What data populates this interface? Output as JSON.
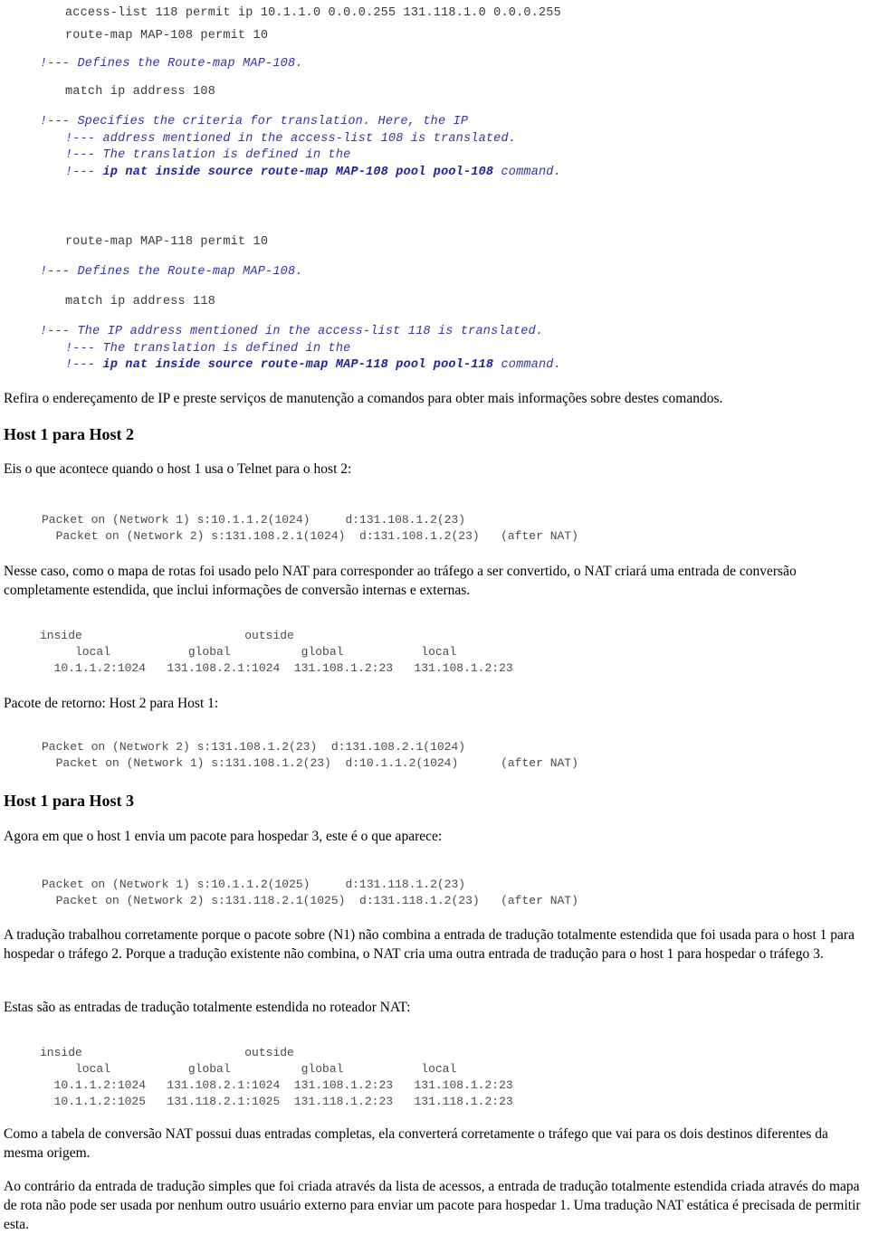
{
  "colors": {
    "comment_blue": "#3333aa",
    "comment_blue_bold": "#2222a0",
    "code_gray": "#3a3a3a",
    "body_black": "#000000",
    "page_background": "#ffffff"
  },
  "config_block_1": {
    "acl_line": "access-list 118 permit ip 10.1.1.0 0.0.0.255 131.118.1.0 0.0.0.255",
    "routemap_line": "route-map MAP-108 permit 10",
    "comment_defines": "!--- Defines the Route-map MAP-108.",
    "match_line": "match ip address 108",
    "comment_specifies_1": "!--- Specifies the criteria for translation. Here, the IP",
    "comment_specifies_2": "!--- address mentioned in the access-list 108 is translated.",
    "comment_specifies_3": "!--- The translation is defined in the",
    "comment_specifies_4_prefix": "!--- ",
    "comment_specifies_4_bold": "ip nat inside source route-map MAP-108 pool pool-108",
    "comment_specifies_4_suffix": " command."
  },
  "config_block_2": {
    "routemap_line": "route-map MAP-118 permit 10",
    "comment_defines": "!--- Defines the Route-map MAP-108.",
    "match_line": "match ip address 118",
    "comment_1": "!--- The IP address mentioned in the access-list 118 is translated.",
    "comment_2": "!--- The translation is defined in the",
    "comment_3_prefix": "!--- ",
    "comment_3_bold": "ip nat inside source route-map MAP-118 pool pool-118",
    "comment_3_suffix": " command."
  },
  "paragraphs": {
    "refira": "Refira o endereçamento de IP e preste serviços de manutenção a comandos para obter mais informações sobre destes comandos.",
    "nesse_caso": "Nesse caso, como o mapa de rotas foi usado pelo NAT para corresponder ao tráfego a ser convertido, o NAT criará uma entrada de conversão completamente estendida, que inclui informações de conversão internas e externas.",
    "pacote_retorno": "Pacote de retorno: Host 2 para Host 1:",
    "eis_o_que": "Eis o que acontece quando o host 1 usa o Telnet para o host 2:",
    "agora_em_que": "Agora em que o host 1 envia um pacote para hospedar 3, este é o que aparece:",
    "traducao_trabalhou": "A tradução trabalhou corretamente porque o pacote sobre (N1) não combina a entrada de tradução totalmente estendida que foi usada para o host 1 para hospedar o tráfego 2. Porque a tradução existente não combina, o NAT cria uma outra entrada de tradução para o host 1 para hospedar o tráfego 3.",
    "estas_sao": "Estas são as entradas de tradução totalmente estendida no roteador NAT:",
    "como_tabela": "Como a tabela de conversão NAT possui duas entradas completas, ela converterá corretamente o tráfego que vai para os dois destinos diferentes da mesma origem.",
    "ao_contrario": "Ao contrário da entrada de tradução simples que foi criada através da lista de acessos, a entrada de tradução totalmente estendida criada através do mapa de rota não pode ser usada por nenhum outro usuário externo para enviar um pacote para hospedar 1. Uma tradução NAT estática é precisada de permitir esta."
  },
  "headings": {
    "host1_host2": "Host 1 para Host 2",
    "host1_host3": "Host 1 para Host 3"
  },
  "trace_host1_host2": {
    "line1": "Packet on (Network 1) s:10.1.1.2(1024)     d:131.108.1.2(23)",
    "line2": "  Packet on (Network 2) s:131.108.2.1(1024)  d:131.108.1.2(23)   (after NAT)"
  },
  "trace_return": {
    "line1": "Packet on (Network 2) s:131.108.1.2(23)  d:131.108.2.1(1024)",
    "line2": "  Packet on (Network 1) s:131.108.1.2(23)  d:10.1.1.2(1024)      (after NAT)"
  },
  "trace_host1_host3": {
    "line1": "Packet on (Network 1) s:10.1.1.2(1025)     d:131.118.1.2(23)",
    "line2": "  Packet on (Network 2) s:131.118.2.1(1025)  d:131.118.1.2(23)   (after NAT)"
  },
  "nat_table_1": {
    "header_side": "inside                       outside",
    "header_cols": "     local           global          global           local",
    "row1": "  10.1.1.2:1024   131.108.2.1:1024  131.108.1.2:23   131.108.1.2:23"
  },
  "nat_table_2": {
    "header_side": "inside                       outside",
    "header_cols": "     local           global          global           local",
    "row1": "  10.1.1.2:1024   131.108.2.1:1024  131.108.1.2:23   131.108.1.2:23",
    "row2": "  10.1.1.2:1025   131.118.2.1:1025  131.118.1.2:23   131.118.1.2:23"
  }
}
